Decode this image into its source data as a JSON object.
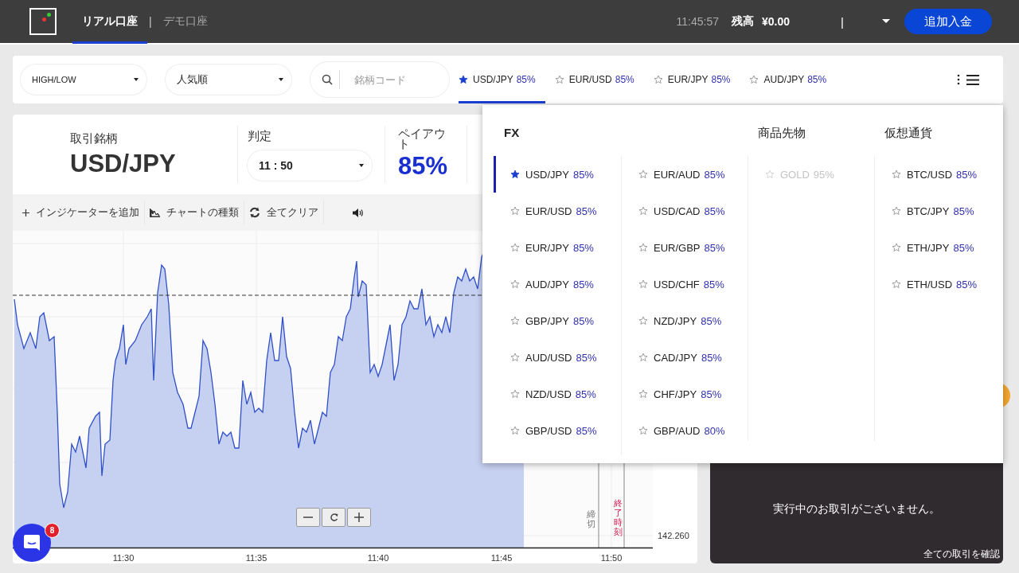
{
  "topbar": {
    "tabs": [
      {
        "label": "リアル口座",
        "selected": true
      },
      {
        "label": "デモ口座",
        "selected": false
      }
    ],
    "separator": "|",
    "time": "11:45:57",
    "balance_label": "残高",
    "balance": "¥0.00",
    "account_separator": "|",
    "deposit_button": "追加入金"
  },
  "toolbar": {
    "option_type": "HIGH/LOW",
    "sort": "人気順",
    "search": {
      "placeholder": "銘柄コード"
    },
    "favorites": [
      {
        "symbol": "USD/JPY",
        "payout": "85%",
        "selected": true,
        "starred": true
      },
      {
        "symbol": "EUR/USD",
        "payout": "85%",
        "selected": false,
        "starred": false
      },
      {
        "symbol": "EUR/JPY",
        "payout": "85%",
        "selected": false,
        "starred": false
      },
      {
        "symbol": "AUD/JPY",
        "payout": "85%",
        "selected": false,
        "starred": false
      }
    ]
  },
  "trade_info": {
    "symbol_label": "取引銘柄",
    "symbol": "USD/JPY",
    "expiry_label": "判定",
    "expiry": "11 : 50",
    "payout_label": "ペイアウト",
    "payout": "85%"
  },
  "chart_tools": [
    {
      "kind": "add",
      "label": "インジケーターを追加"
    },
    {
      "kind": "type",
      "label": "チャートの種類"
    },
    {
      "kind": "clear",
      "label": "全てクリア"
    },
    {
      "kind": "sound"
    }
  ],
  "chart": {
    "x_labels": [
      "11:30",
      "11:35",
      "11:40",
      "11:45",
      "11:50"
    ],
    "y_labels": [
      "142.260"
    ],
    "deadline_label": "締切",
    "end_label": "終了時刻"
  },
  "positions": {
    "empty_message": "実行中のお取引がございません。",
    "all_trades_link": "全ての取引を確認"
  },
  "chat": {
    "badge": "8"
  },
  "symbol_menu": {
    "groups": [
      {
        "title": "FX",
        "columns": [
          {
            "items": [
              {
                "symbol": "USD/JPY",
                "payout": "85%",
                "selected": true,
                "starred": true,
                "disabled": false
              },
              {
                "symbol": "EUR/USD",
                "payout": "85%",
                "selected": false,
                "starred": false,
                "disabled": false
              },
              {
                "symbol": "EUR/JPY",
                "payout": "85%",
                "selected": false,
                "starred": false,
                "disabled": false
              },
              {
                "symbol": "AUD/JPY",
                "payout": "85%",
                "selected": false,
                "starred": false,
                "disabled": false
              },
              {
                "symbol": "GBP/JPY",
                "payout": "85%",
                "selected": false,
                "starred": false,
                "disabled": false
              },
              {
                "symbol": "AUD/USD",
                "payout": "85%",
                "selected": false,
                "starred": false,
                "disabled": false
              },
              {
                "symbol": "NZD/USD",
                "payout": "85%",
                "selected": false,
                "starred": false,
                "disabled": false
              },
              {
                "symbol": "GBP/USD",
                "payout": "85%",
                "selected": false,
                "starred": false,
                "disabled": false
              }
            ]
          },
          {
            "items": [
              {
                "symbol": "EUR/AUD",
                "payout": "85%",
                "selected": false,
                "starred": false,
                "disabled": false
              },
              {
                "symbol": "USD/CAD",
                "payout": "85%",
                "selected": false,
                "starred": false,
                "disabled": false
              },
              {
                "symbol": "EUR/GBP",
                "payout": "85%",
                "selected": false,
                "starred": false,
                "disabled": false
              },
              {
                "symbol": "USD/CHF",
                "payout": "85%",
                "selected": false,
                "starred": false,
                "disabled": false
              },
              {
                "symbol": "NZD/JPY",
                "payout": "85%",
                "selected": false,
                "starred": false,
                "disabled": false
              },
              {
                "symbol": "CAD/JPY",
                "payout": "85%",
                "selected": false,
                "starred": false,
                "disabled": false
              },
              {
                "symbol": "CHF/JPY",
                "payout": "85%",
                "selected": false,
                "starred": false,
                "disabled": false
              },
              {
                "symbol": "GBP/AUD",
                "payout": "80%",
                "selected": false,
                "starred": false,
                "disabled": false
              }
            ]
          }
        ]
      },
      {
        "title": "商品先物",
        "columns": [
          {
            "items": [
              {
                "symbol": "GOLD",
                "payout": "95%",
                "selected": false,
                "starred": false,
                "disabled": true
              }
            ]
          }
        ]
      },
      {
        "title": "仮想通貨",
        "columns": [
          {
            "items": [
              {
                "symbol": "BTC/USD",
                "payout": "85%",
                "selected": false,
                "starred": false,
                "disabled": false
              },
              {
                "symbol": "BTC/JPY",
                "payout": "85%",
                "selected": false,
                "starred": false,
                "disabled": false
              },
              {
                "symbol": "ETH/JPY",
                "payout": "85%",
                "selected": false,
                "starred": false,
                "disabled": false
              },
              {
                "symbol": "ETH/USD",
                "payout": "85%",
                "selected": false,
                "starred": false,
                "disabled": false
              }
            ]
          }
        ]
      }
    ]
  }
}
